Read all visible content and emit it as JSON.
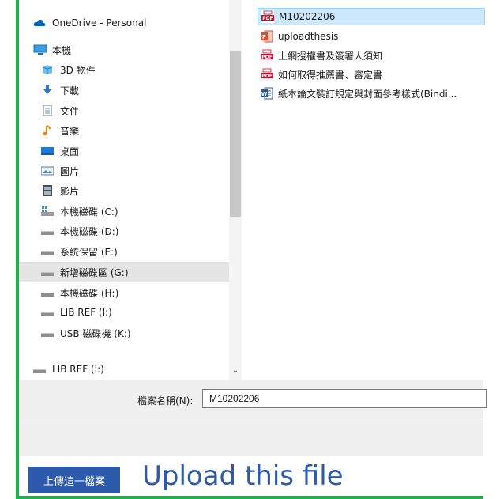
{
  "sidebar": {
    "items": [
      {
        "label": "OneDrive - Personal",
        "icon": "onedrive-cloud-icon"
      },
      {
        "label": "本機",
        "icon": "computer-icon"
      },
      {
        "label": "3D 物件",
        "icon": "3d-objects-icon"
      },
      {
        "label": "下載",
        "icon": "download-icon"
      },
      {
        "label": "文件",
        "icon": "documents-icon"
      },
      {
        "label": "音樂",
        "icon": "music-icon"
      },
      {
        "label": "桌面",
        "icon": "desktop-icon"
      },
      {
        "label": "圖片",
        "icon": "pictures-icon"
      },
      {
        "label": "影片",
        "icon": "videos-icon"
      },
      {
        "label": "本機磁碟 (C:)",
        "icon": "windows-drive-icon"
      },
      {
        "label": "本機磁碟 (D:)",
        "icon": "drive-icon"
      },
      {
        "label": "系統保留 (E:)",
        "icon": "drive-icon"
      },
      {
        "label": "新增磁碟區 (G:)",
        "icon": "drive-icon"
      },
      {
        "label": "本機磁碟 (H:)",
        "icon": "drive-icon"
      },
      {
        "label": "LIB REF (I:)",
        "icon": "drive-icon"
      },
      {
        "label": "USB 磁碟機 (K:)",
        "icon": "usb-drive-icon"
      },
      {
        "label": "LIB REF (I:)",
        "icon": "drive-icon"
      }
    ],
    "selected_index": 12
  },
  "files": [
    {
      "name": "M10202206",
      "icon": "pdf-icon"
    },
    {
      "name": "uploadthesis",
      "icon": "powerpoint-icon"
    },
    {
      "name": "上網授權書及簽署人須知",
      "icon": "pdf-icon"
    },
    {
      "name": "如何取得推薦書、審定書",
      "icon": "pdf-icon"
    },
    {
      "name": "紙本論文裝訂規定與封面參考樣式(Bindi...",
      "icon": "word-icon"
    }
  ],
  "filename": {
    "label": "檔案名稱(N):",
    "value": "M10202206"
  },
  "upload": {
    "button_label": "上傳這一檔案",
    "caption": "Upload this file"
  },
  "colors": {
    "frame_border": "#21b14b",
    "accent": "#2e5aac",
    "selection": "#cce8ff"
  }
}
